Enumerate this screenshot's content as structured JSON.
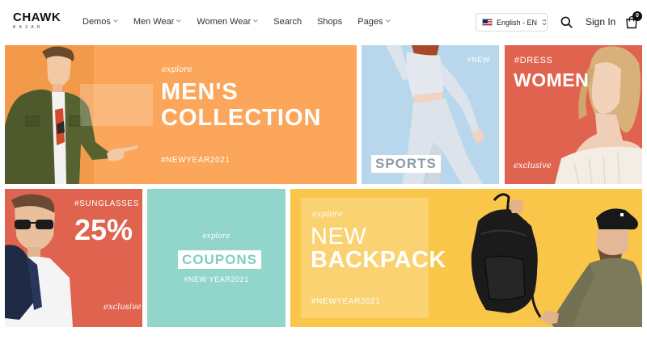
{
  "header": {
    "logo": {
      "main": "CHAWK",
      "sub": "BAZAR"
    },
    "nav": [
      {
        "label": "Demos",
        "has_dropdown": true
      },
      {
        "label": "Men Wear",
        "has_dropdown": true
      },
      {
        "label": "Women Wear",
        "has_dropdown": true
      },
      {
        "label": "Search",
        "has_dropdown": false
      },
      {
        "label": "Shops",
        "has_dropdown": false
      },
      {
        "label": "Pages",
        "has_dropdown": true
      }
    ],
    "language": {
      "label": "English - EN",
      "flag_icon": "us-flag-icon"
    },
    "search_icon": "search-icon",
    "signin_label": "Sign In",
    "cart": {
      "icon": "shopping-bag-icon",
      "count": "0"
    }
  },
  "banners": {
    "men": {
      "explore": "explore",
      "title_line1": "MEN'S",
      "title_line2": "COLLECTION",
      "tag": "#NEWYEAR2021",
      "bg": "#fba65a"
    },
    "sports": {
      "tag": "#NEW",
      "label": "SPORTS",
      "bg": "#b9d7ec"
    },
    "women": {
      "tag": "#DRESS",
      "title": "WOMEN",
      "note": "exclusive",
      "bg": "#e0634f"
    },
    "sunglasses": {
      "tag": "#SUNGLASSES",
      "title": "25%",
      "note": "exclusive",
      "bg": "#e0634f"
    },
    "coupons": {
      "explore": "explore",
      "label": "COUPONS",
      "tag": "#NEW YEAR2021",
      "bg": "#92d6cb"
    },
    "backpack": {
      "explore": "explore",
      "title_line1": "NEW",
      "title_line2": "BACKPACK",
      "tag": "#NEWYEAR2021",
      "bg": "#f9c649"
    }
  }
}
